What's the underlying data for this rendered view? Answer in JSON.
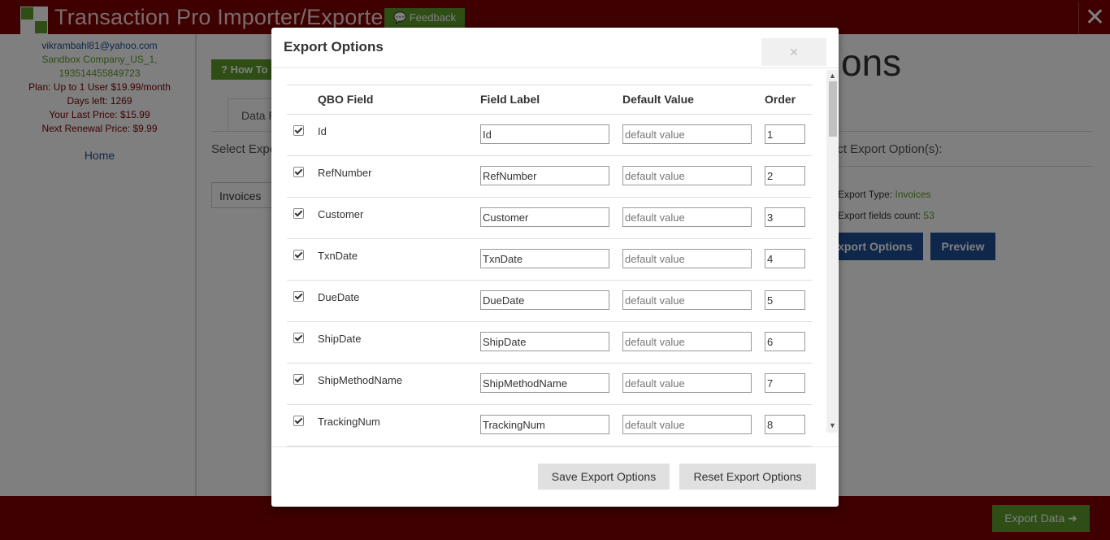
{
  "app": {
    "title": "Transaction Pro Importer/Exporter",
    "feedback_label": "Feedback",
    "close_symbol": "✕"
  },
  "sidebar": {
    "email": "vikrambahl81@yahoo.com",
    "company": "Sandbox Company_US_1,",
    "company_id": "193514455849723",
    "plan": "Plan: Up to 1 User $19.99/month",
    "days_left": "Days left: 1269",
    "last_price": "Your Last Price: $15.99",
    "renewal_price": "Next Renewal Price: $9.99",
    "home_link": "Home"
  },
  "main": {
    "howto_label": "How To",
    "tab_label": "Data F",
    "select_export_left": "Select Expo",
    "selected_type": "Invoices",
    "page_title_fragment": "ons",
    "select_export_right": "ect Export Option(s):",
    "export_type_label": "Export Type: ",
    "export_type_value": "Invoices",
    "export_count_label": "Export fields count: ",
    "export_count_value": "53",
    "export_options_btn": "xport Options",
    "preview_btn": "Preview",
    "export_data_btn": "Export Data ➜"
  },
  "modal": {
    "title": "Export Options",
    "close_symbol": "×",
    "columns": [
      "QBO Field",
      "Field Label",
      "Default Value",
      "Order"
    ],
    "default_placeholder": "default value",
    "rows": [
      {
        "field": "Id",
        "label": "Id",
        "order": "1",
        "checked": true
      },
      {
        "field": "RefNumber",
        "label": "RefNumber",
        "order": "2",
        "checked": true
      },
      {
        "field": "Customer",
        "label": "Customer",
        "order": "3",
        "checked": true
      },
      {
        "field": "TxnDate",
        "label": "TxnDate",
        "order": "4",
        "checked": true
      },
      {
        "field": "DueDate",
        "label": "DueDate",
        "order": "5",
        "checked": true
      },
      {
        "field": "ShipDate",
        "label": "ShipDate",
        "order": "6",
        "checked": true
      },
      {
        "field": "ShipMethodName",
        "label": "ShipMethodName",
        "order": "7",
        "checked": true
      },
      {
        "field": "TrackingNum",
        "label": "TrackingNum",
        "order": "8",
        "checked": true
      }
    ],
    "save_btn": "Save Export Options",
    "reset_btn": "Reset Export Options"
  },
  "colors": {
    "brand_red": "#7d0000",
    "green": "#5e9c2d",
    "blue": "#1f4e96"
  }
}
